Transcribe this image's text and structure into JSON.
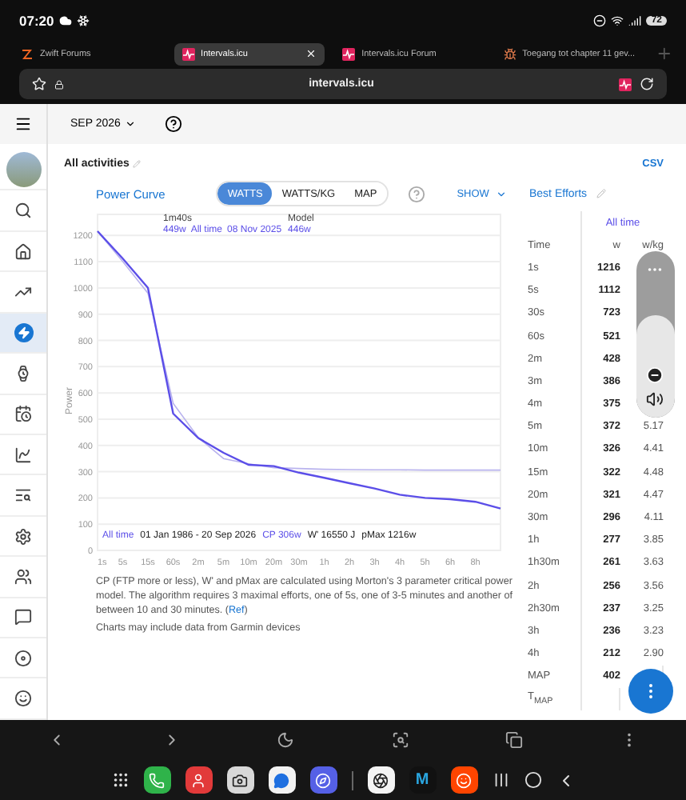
{
  "status_bar": {
    "time": "07:20",
    "battery": "72"
  },
  "browser_tabs": [
    {
      "title": "Zwift Forums",
      "selected": false,
      "kind": "zwift"
    },
    {
      "title": "Intervals.icu",
      "selected": true,
      "kind": "intervals"
    },
    {
      "title": "Intervals.icu Forum",
      "selected": false,
      "kind": "intervals"
    },
    {
      "title": "Toegang tot chapter 11 gev...",
      "selected": false,
      "kind": "bug"
    }
  ],
  "address_bar": {
    "url": "intervals.icu"
  },
  "app_bar": {
    "month": "SEP 2026"
  },
  "sidebar": {
    "items": [
      {
        "kind": "avatar",
        "selected": false
      },
      {
        "kind": "search",
        "selected": false
      },
      {
        "kind": "home",
        "selected": false
      },
      {
        "kind": "trend",
        "selected": false
      },
      {
        "kind": "power",
        "selected": true
      },
      {
        "kind": "watch",
        "selected": false
      },
      {
        "kind": "calendar",
        "selected": false
      },
      {
        "kind": "charts",
        "selected": false
      },
      {
        "kind": "list-search",
        "selected": false
      },
      {
        "kind": "settings",
        "selected": false
      },
      {
        "kind": "people",
        "selected": false
      },
      {
        "kind": "chat",
        "selected": false
      },
      {
        "kind": "disc",
        "selected": false
      },
      {
        "kind": "face",
        "selected": false
      }
    ]
  },
  "header": {
    "title": "All activities",
    "csv": "CSV"
  },
  "power_curve": {
    "title": "Power Curve",
    "units": [
      {
        "label": "WATTS",
        "selected": true
      },
      {
        "label": "WATTS/KG",
        "selected": false
      },
      {
        "label": "MAP",
        "selected": false
      }
    ],
    "show": "SHOW",
    "tooltip": {
      "duration": "1m40s",
      "value": "449w",
      "period": "All time",
      "date": "08 Nov 2025",
      "model_value": "446w"
    },
    "summary": {
      "range": "01 Jan 1986 - 20 Sep 2026",
      "cp": "CP 306w",
      "w_prime": "W' 16550 J",
      "pmax": "pMax 1216w"
    },
    "chart_data": {
      "type": "line",
      "ylabel": "Power",
      "grid": true,
      "categories": [
        "1s",
        "5s",
        "15s",
        "60s",
        "2m",
        "5m",
        "10m",
        "20m",
        "30m",
        "1h",
        "2h",
        "3h",
        "4h",
        "5h",
        "6h",
        "8h",
        null
      ],
      "series": [
        {
          "name": "All time",
          "color": "#5b4ee8",
          "values": [
            1216,
            1112,
            1000,
            521,
            428,
            372,
            326,
            321,
            296,
            277,
            256,
            236,
            212,
            200,
            195,
            185,
            160
          ]
        },
        {
          "name": "Model",
          "color": "#b9b3ee",
          "values": [
            1216,
            1100,
            980,
            560,
            430,
            350,
            330,
            315,
            312,
            309,
            308,
            307,
            307,
            306,
            306,
            306,
            306
          ]
        }
      ],
      "ylim": [
        0,
        1280
      ],
      "yticks": [
        0,
        100,
        200,
        300,
        400,
        500,
        600,
        700,
        800,
        900,
        1000,
        1100,
        1200
      ]
    }
  },
  "notes": {
    "text": "CP (FTP more or less), W' and pMax are calculated using Morton's 3 parameter critical power model. The algorithm requires 3 maximal efforts, one of 5s, one of 3-5 minutes and another of between 10 and 30 minutes. (",
    "link": "Ref",
    "after": ")",
    "garmin": "Charts may include data from Garmin devices"
  },
  "best_efforts": {
    "title": "Best Efforts",
    "period": "All time",
    "columns": [
      "Time",
      "w",
      "w/kg"
    ],
    "rows": [
      {
        "time": "1s",
        "w": "1216"
      },
      {
        "time": "5s",
        "w": "1112"
      },
      {
        "time": "30s",
        "w": "723"
      },
      {
        "time": "60s",
        "w": "521"
      },
      {
        "time": "2m",
        "w": "428"
      },
      {
        "time": "3m",
        "w": "386"
      },
      {
        "time": "4m",
        "w": "375"
      },
      {
        "time": "5m",
        "w": "372",
        "wkg": "5.17"
      },
      {
        "time": "10m",
        "w": "326",
        "wkg": "4.41"
      },
      {
        "time": "15m",
        "w": "322",
        "wkg": "4.48"
      },
      {
        "time": "20m",
        "w": "321",
        "wkg": "4.47"
      },
      {
        "time": "30m",
        "w": "296",
        "wkg": "4.11"
      },
      {
        "time": "1h",
        "w": "277",
        "wkg": "3.85"
      },
      {
        "time": "1h30m",
        "w": "261",
        "wkg": "3.63"
      },
      {
        "time": "2h",
        "w": "256",
        "wkg": "3.56"
      },
      {
        "time": "2h30m",
        "w": "237",
        "wkg": "3.25"
      },
      {
        "time": "3h",
        "w": "236",
        "wkg": "3.23"
      },
      {
        "time": "4h",
        "w": "212",
        "wkg": "2.90"
      },
      {
        "time": "MAP",
        "w": "402"
      },
      {
        "time": "T$_{MAP}$"
      }
    ]
  },
  "volume_panel": {
    "level": 0.62
  },
  "nav_bar": {
    "items": [
      {
        "kind": "back"
      },
      {
        "kind": "forward"
      },
      {
        "kind": "moon"
      },
      {
        "kind": "scan"
      },
      {
        "kind": "tabs"
      },
      {
        "kind": "more"
      }
    ]
  },
  "dock": {
    "apps": [
      {
        "kind": "grid"
      },
      {
        "kind": "phone"
      },
      {
        "kind": "contacts"
      },
      {
        "kind": "camera"
      },
      {
        "kind": "messages"
      },
      {
        "kind": "browser"
      },
      {
        "kind": "divider"
      },
      {
        "kind": "aperture"
      },
      {
        "kind": "letter",
        "label": "M"
      },
      {
        "kind": "reddit"
      },
      {
        "kind": "recents"
      },
      {
        "kind": "home"
      },
      {
        "kind": "back"
      }
    ]
  }
}
